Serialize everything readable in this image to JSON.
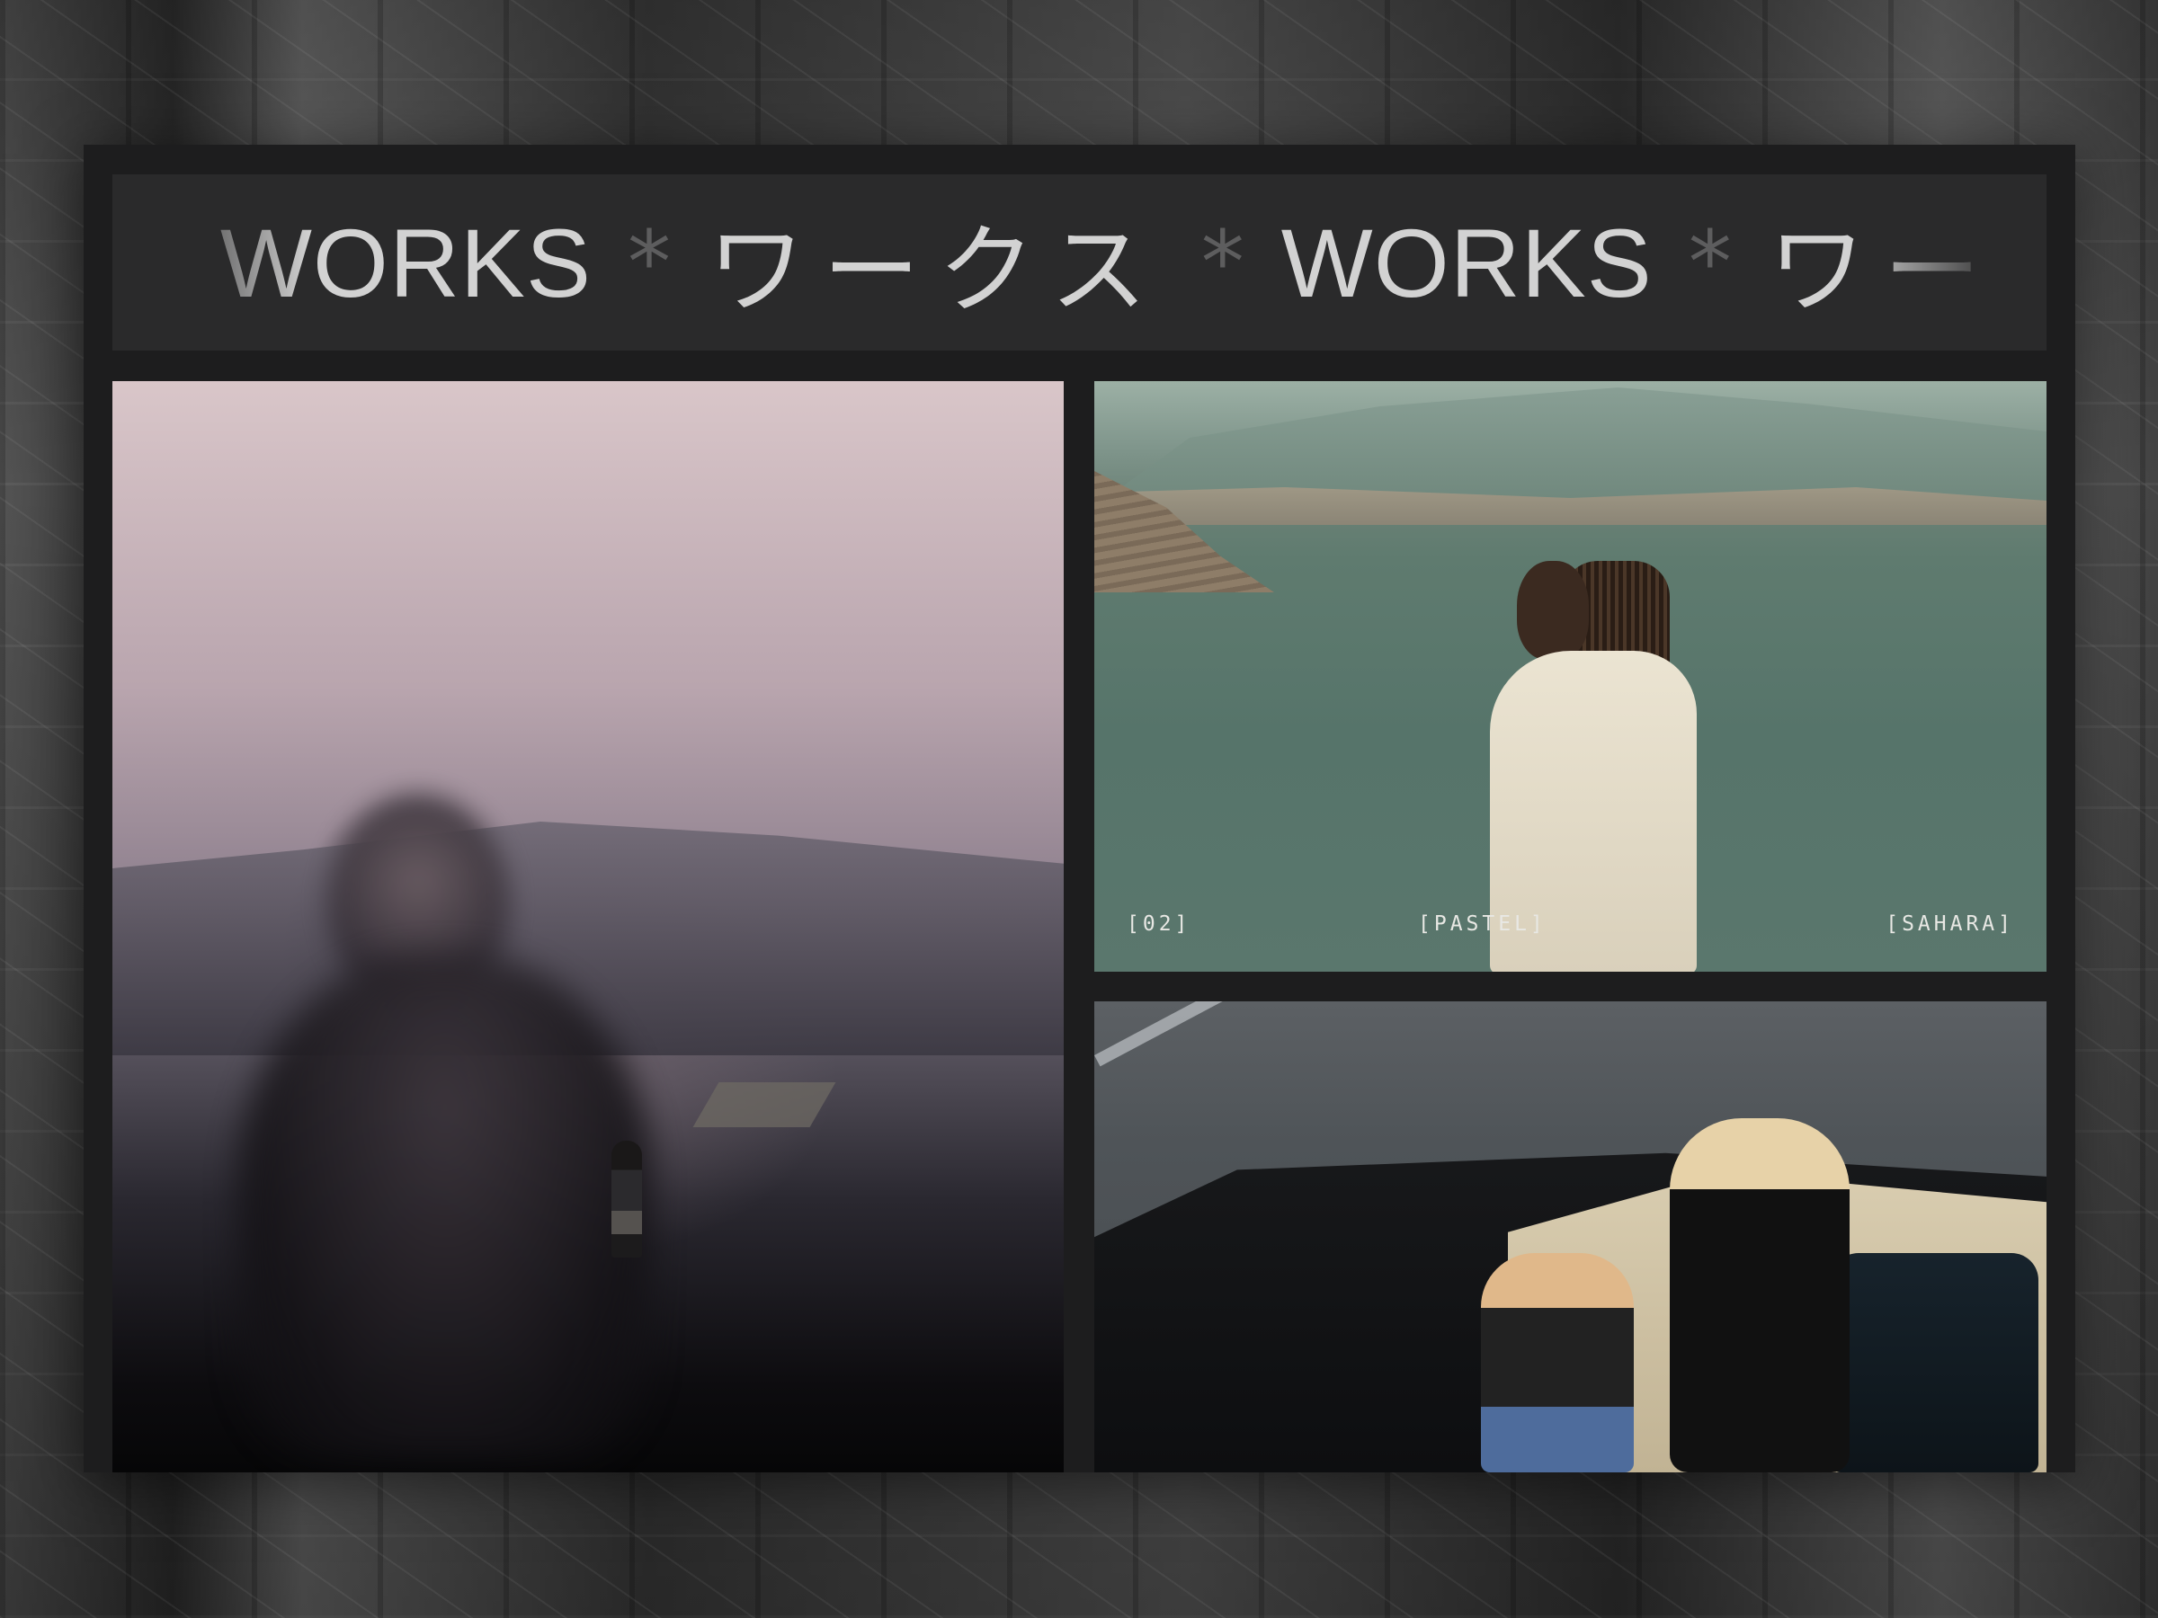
{
  "banner": {
    "marquee": [
      {
        "kind": "word",
        "text": "WORKS"
      },
      {
        "kind": "star",
        "text": "*"
      },
      {
        "kind": "jp",
        "text": "ワークス"
      },
      {
        "kind": "star",
        "text": "*"
      },
      {
        "kind": "word",
        "text": "WORKS"
      },
      {
        "kind": "star",
        "text": "*"
      },
      {
        "kind": "jp",
        "text": "ワークス"
      }
    ]
  },
  "gallery": {
    "photo_2": {
      "captions": [
        "[02]",
        "[PASTEL]",
        "[SAHARA]"
      ]
    }
  }
}
